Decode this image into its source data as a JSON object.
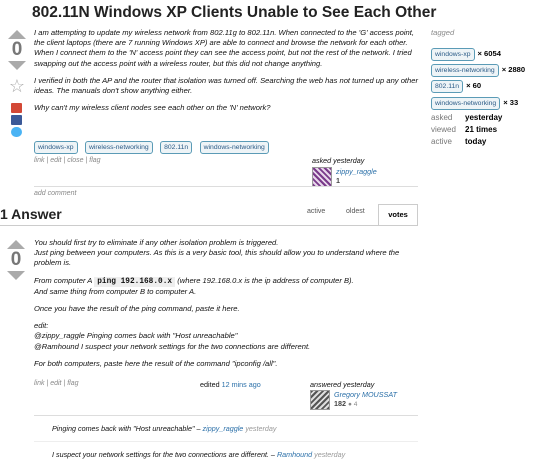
{
  "question": {
    "title": "802.11N Windows XP Clients Unable to See Each Other",
    "votes": "0",
    "paragraphs": [
      "I am attempting to update my wireless network from 802.11g to 802.11n. When connected to the 'G' access point, the client laptops (there are 7 running Windows XP) are able to connect and browse the network for each other. When I connect them to the 'N' access point they can see the access point, but not the rest of the network. I tried swapping out the access point with a wireless router, but this did not change anything.",
      "I verified in both the AP and the router that isolation was turned off. Searching the web has not turned up any other ideas. The manuals don't show anything either.",
      "Why can't my wireless client nodes see each other on the 'N' network?"
    ],
    "tags": [
      "windows-xp",
      "wireless-networking",
      "802.11n",
      "windows-networking"
    ],
    "actions": "link | edit | close | flag",
    "asked_label": "asked yesterday",
    "user_name": "zippy_raggle",
    "user_rep": "1",
    "add_comment": "add comment"
  },
  "sidebar": {
    "tagged_label": "tagged",
    "tags": [
      {
        "name": "windows-xp",
        "count": "× 6054"
      },
      {
        "name": "wireless-networking",
        "count": "× 2880"
      },
      {
        "name": "802.11n",
        "count": "× 60"
      },
      {
        "name": "windows-networking",
        "count": "× 33"
      }
    ],
    "stats": [
      {
        "label": "asked",
        "value": "yesterday"
      },
      {
        "label": "viewed",
        "value": "21 times"
      },
      {
        "label": "active",
        "value": "today"
      }
    ]
  },
  "answers_header": {
    "count": "1 Answer",
    "tabs": [
      "active",
      "oldest",
      "votes"
    ]
  },
  "answer": {
    "votes": "0",
    "p1a": "You should first try to eliminate if any other isolation problem is triggered.",
    "p1b": "Just ping between your computers. As this is a very basic tool, this should allow you to understand where the problem is.",
    "p2_pre": "From computer A",
    "p2_code": "ping 192.168.0.x",
    "p2_post": "(where 192.168.0.x is the ip address of computer B).",
    "p2b": "And same thing from computer B to computer A.",
    "p3": "Once you have the result of the ping command, paste it here.",
    "edit_label": "edit:",
    "edit1": "@zippy_raggle Pinging comes back with \"Host unreachable\"",
    "edit2": "@Ramhound I suspect your network settings for the two connections are different.",
    "p4": "For both computers, paste here the result of the command \"ipconfig /all\".",
    "actions": "link | edit | flag",
    "edited_label": "edited",
    "edited_time": "12 mins ago",
    "answered_label": "answered yesterday",
    "user_name": "Gregory MOUSSAT",
    "user_rep": "182",
    "user_badge": "● 4"
  },
  "comments": [
    {
      "text": "Pinging comes back with \"Host unreachable\" –",
      "user": "zippy_raggle",
      "time": "yesterday"
    },
    {
      "text": "I suspect your network settings for the two connections are different. –",
      "user": "Ramhound",
      "time": "yesterday"
    }
  ]
}
